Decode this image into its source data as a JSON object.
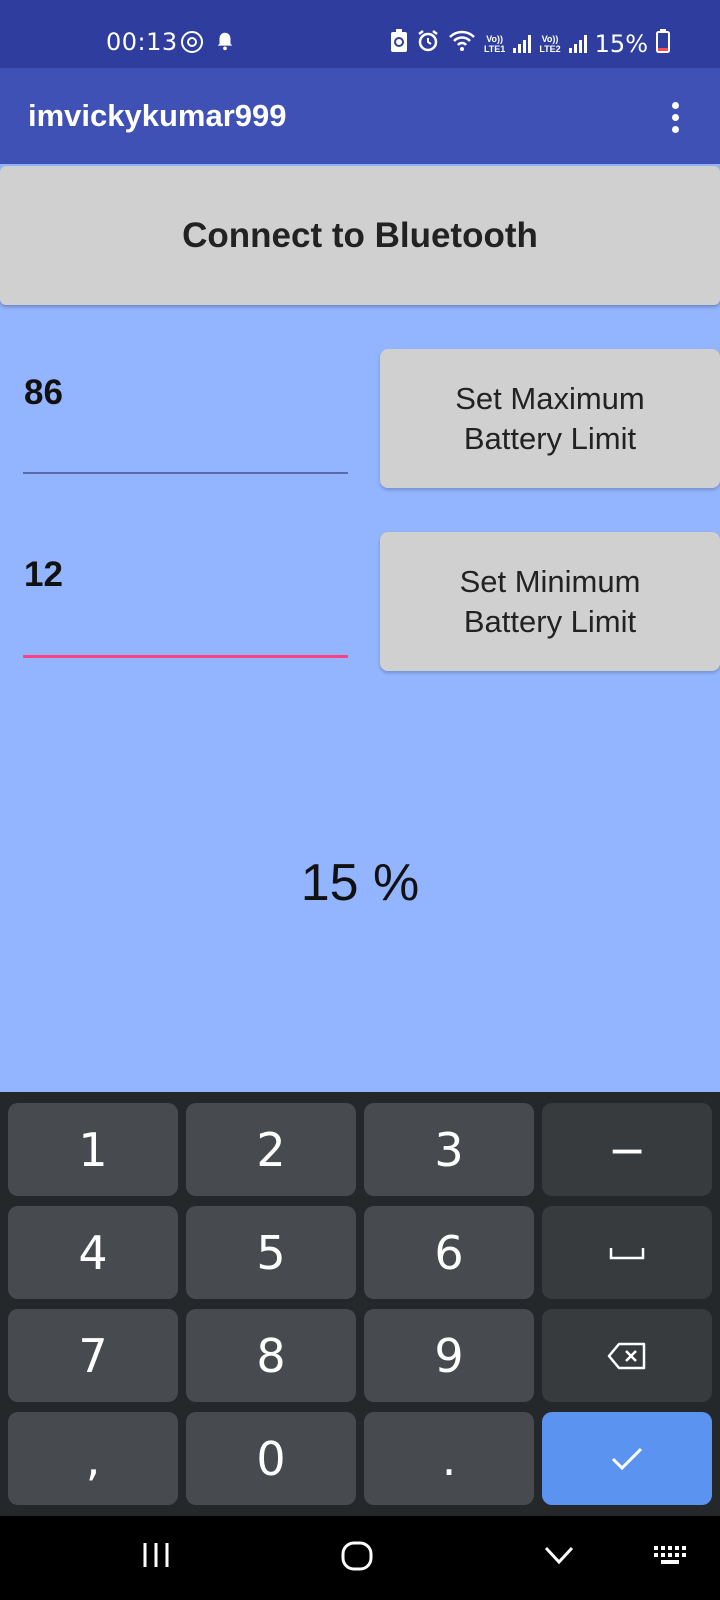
{
  "status_bar": {
    "time": "00:13",
    "battery_percent": "15%",
    "net1_top": "Vo))",
    "net1_bottom": "LTE1",
    "net2_top": "Vo))",
    "net2_bottom": "LTE2",
    "icons": [
      "sync-icon",
      "notification-bell-icon",
      "battery-saver-icon",
      "alarm-icon",
      "wifi-icon",
      "signal-icon",
      "battery-icon"
    ]
  },
  "app_bar": {
    "title": "imvickykumar999",
    "menu_icon": "overflow-menu-icon"
  },
  "connect_button": {
    "label": "Connect to Bluetooth"
  },
  "max_limit": {
    "value": "86",
    "button_label": "Set Maximum\nBattery Limit"
  },
  "min_limit": {
    "value": "12",
    "button_label": "Set Minimum\nBattery Limit"
  },
  "battery_display": {
    "text": "15 %"
  },
  "keyboard": {
    "rows": [
      [
        "1",
        "2",
        "3",
        "−"
      ],
      [
        "4",
        "5",
        "6",
        "␣"
      ],
      [
        "7",
        "8",
        "9",
        "⌫"
      ],
      [
        ",",
        "0",
        ".",
        "✓"
      ]
    ]
  },
  "nav_bar": {
    "icons": [
      "recents-icon",
      "home-icon",
      "hide-keyboard-icon",
      "keyboard-switch-icon"
    ]
  },
  "colors": {
    "status_bar": "#2f3e9e",
    "app_bar": "#3f51b5",
    "background": "#93b4fe",
    "button": "#d0d0d0",
    "max_underline": "#5a6aa8",
    "min_underline": "#ff4081",
    "enter_key": "#5b93f0"
  }
}
